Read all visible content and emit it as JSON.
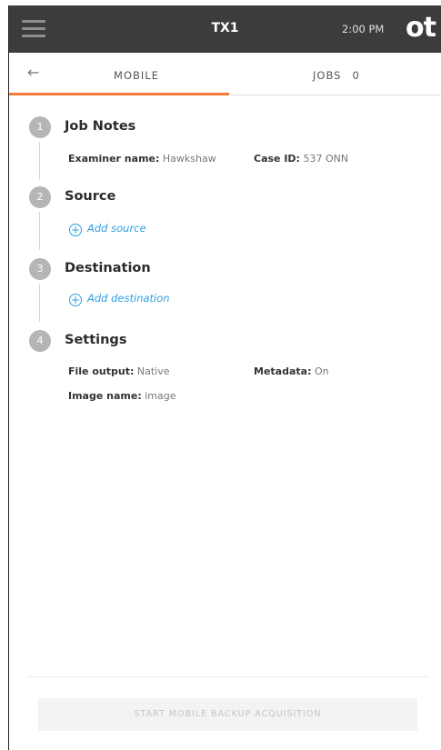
{
  "header": {
    "title": "TX1",
    "time": "2:00 PM",
    "logo": "ot"
  },
  "tabs": {
    "back_icon": "←",
    "mobile_label": "MOBILE",
    "jobs_label": "JOBS",
    "jobs_count": "0",
    "active_color": "#f07a3a"
  },
  "steps": {
    "job_notes": {
      "number": "1",
      "title": "Job Notes",
      "examiner_label": "Examiner name:",
      "examiner_value": "Hawkshaw",
      "case_label": "Case ID:",
      "case_value": "537 ONN"
    },
    "source": {
      "number": "2",
      "title": "Source",
      "add_label": "Add source"
    },
    "destination": {
      "number": "3",
      "title": "Destination",
      "add_label": "Add destination"
    },
    "settings": {
      "number": "4",
      "title": "Settings",
      "file_output_label": "File output:",
      "file_output_value": "Native",
      "metadata_label": "Metadata:",
      "metadata_value": "On",
      "image_name_label": "Image name:",
      "image_name_value": "image"
    }
  },
  "footer": {
    "start_label": "START MOBILE BACKUP ACQUISITION"
  },
  "colors": {
    "header_bg": "#3c3c3c",
    "link": "#2f9fe0",
    "badge": "#b5b5b5"
  }
}
